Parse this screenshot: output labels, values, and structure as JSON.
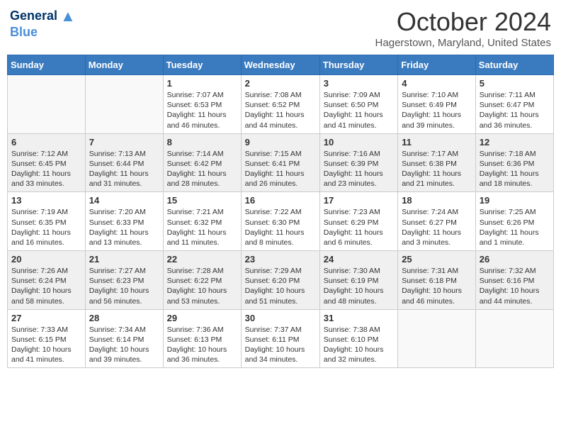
{
  "header": {
    "logo_line1": "General",
    "logo_line2": "Blue",
    "month": "October 2024",
    "location": "Hagerstown, Maryland, United States"
  },
  "days_of_week": [
    "Sunday",
    "Monday",
    "Tuesday",
    "Wednesday",
    "Thursday",
    "Friday",
    "Saturday"
  ],
  "weeks": [
    [
      {
        "day": "",
        "text": ""
      },
      {
        "day": "",
        "text": ""
      },
      {
        "day": "1",
        "text": "Sunrise: 7:07 AM\nSunset: 6:53 PM\nDaylight: 11 hours and 46 minutes."
      },
      {
        "day": "2",
        "text": "Sunrise: 7:08 AM\nSunset: 6:52 PM\nDaylight: 11 hours and 44 minutes."
      },
      {
        "day": "3",
        "text": "Sunrise: 7:09 AM\nSunset: 6:50 PM\nDaylight: 11 hours and 41 minutes."
      },
      {
        "day": "4",
        "text": "Sunrise: 7:10 AM\nSunset: 6:49 PM\nDaylight: 11 hours and 39 minutes."
      },
      {
        "day": "5",
        "text": "Sunrise: 7:11 AM\nSunset: 6:47 PM\nDaylight: 11 hours and 36 minutes."
      }
    ],
    [
      {
        "day": "6",
        "text": "Sunrise: 7:12 AM\nSunset: 6:45 PM\nDaylight: 11 hours and 33 minutes."
      },
      {
        "day": "7",
        "text": "Sunrise: 7:13 AM\nSunset: 6:44 PM\nDaylight: 11 hours and 31 minutes."
      },
      {
        "day": "8",
        "text": "Sunrise: 7:14 AM\nSunset: 6:42 PM\nDaylight: 11 hours and 28 minutes."
      },
      {
        "day": "9",
        "text": "Sunrise: 7:15 AM\nSunset: 6:41 PM\nDaylight: 11 hours and 26 minutes."
      },
      {
        "day": "10",
        "text": "Sunrise: 7:16 AM\nSunset: 6:39 PM\nDaylight: 11 hours and 23 minutes."
      },
      {
        "day": "11",
        "text": "Sunrise: 7:17 AM\nSunset: 6:38 PM\nDaylight: 11 hours and 21 minutes."
      },
      {
        "day": "12",
        "text": "Sunrise: 7:18 AM\nSunset: 6:36 PM\nDaylight: 11 hours and 18 minutes."
      }
    ],
    [
      {
        "day": "13",
        "text": "Sunrise: 7:19 AM\nSunset: 6:35 PM\nDaylight: 11 hours and 16 minutes."
      },
      {
        "day": "14",
        "text": "Sunrise: 7:20 AM\nSunset: 6:33 PM\nDaylight: 11 hours and 13 minutes."
      },
      {
        "day": "15",
        "text": "Sunrise: 7:21 AM\nSunset: 6:32 PM\nDaylight: 11 hours and 11 minutes."
      },
      {
        "day": "16",
        "text": "Sunrise: 7:22 AM\nSunset: 6:30 PM\nDaylight: 11 hours and 8 minutes."
      },
      {
        "day": "17",
        "text": "Sunrise: 7:23 AM\nSunset: 6:29 PM\nDaylight: 11 hours and 6 minutes."
      },
      {
        "day": "18",
        "text": "Sunrise: 7:24 AM\nSunset: 6:27 PM\nDaylight: 11 hours and 3 minutes."
      },
      {
        "day": "19",
        "text": "Sunrise: 7:25 AM\nSunset: 6:26 PM\nDaylight: 11 hours and 1 minute."
      }
    ],
    [
      {
        "day": "20",
        "text": "Sunrise: 7:26 AM\nSunset: 6:24 PM\nDaylight: 10 hours and 58 minutes."
      },
      {
        "day": "21",
        "text": "Sunrise: 7:27 AM\nSunset: 6:23 PM\nDaylight: 10 hours and 56 minutes."
      },
      {
        "day": "22",
        "text": "Sunrise: 7:28 AM\nSunset: 6:22 PM\nDaylight: 10 hours and 53 minutes."
      },
      {
        "day": "23",
        "text": "Sunrise: 7:29 AM\nSunset: 6:20 PM\nDaylight: 10 hours and 51 minutes."
      },
      {
        "day": "24",
        "text": "Sunrise: 7:30 AM\nSunset: 6:19 PM\nDaylight: 10 hours and 48 minutes."
      },
      {
        "day": "25",
        "text": "Sunrise: 7:31 AM\nSunset: 6:18 PM\nDaylight: 10 hours and 46 minutes."
      },
      {
        "day": "26",
        "text": "Sunrise: 7:32 AM\nSunset: 6:16 PM\nDaylight: 10 hours and 44 minutes."
      }
    ],
    [
      {
        "day": "27",
        "text": "Sunrise: 7:33 AM\nSunset: 6:15 PM\nDaylight: 10 hours and 41 minutes."
      },
      {
        "day": "28",
        "text": "Sunrise: 7:34 AM\nSunset: 6:14 PM\nDaylight: 10 hours and 39 minutes."
      },
      {
        "day": "29",
        "text": "Sunrise: 7:36 AM\nSunset: 6:13 PM\nDaylight: 10 hours and 36 minutes."
      },
      {
        "day": "30",
        "text": "Sunrise: 7:37 AM\nSunset: 6:11 PM\nDaylight: 10 hours and 34 minutes."
      },
      {
        "day": "31",
        "text": "Sunrise: 7:38 AM\nSunset: 6:10 PM\nDaylight: 10 hours and 32 minutes."
      },
      {
        "day": "",
        "text": ""
      },
      {
        "day": "",
        "text": ""
      }
    ]
  ]
}
